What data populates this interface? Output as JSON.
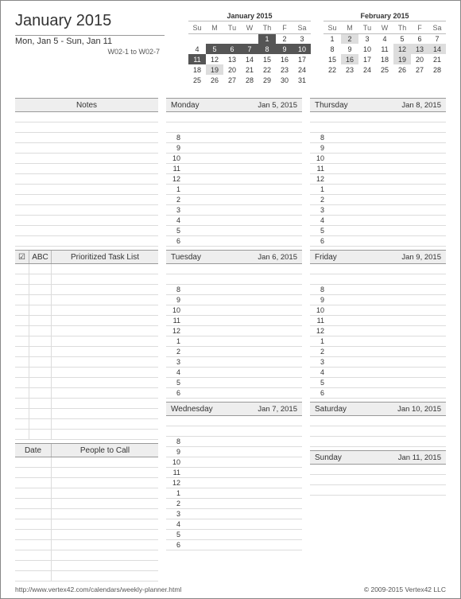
{
  "title": "January 2015",
  "week_range": "Mon, Jan 5  -  Sun, Jan 11",
  "week_codes": "W02-1 to W02-7",
  "minicals": [
    {
      "title": "January 2015",
      "dows": [
        "Su",
        "M",
        "Tu",
        "W",
        "Th",
        "F",
        "Sa"
      ],
      "cells": [
        [
          "",
          "",
          "",
          "",
          "1",
          "2",
          "3"
        ],
        [
          "4",
          "5",
          "6",
          "7",
          "8",
          "9",
          "10"
        ],
        [
          "11",
          "12",
          "13",
          "14",
          "15",
          "16",
          "17"
        ],
        [
          "18",
          "19",
          "20",
          "21",
          "22",
          "23",
          "24"
        ],
        [
          "25",
          "26",
          "27",
          "28",
          "29",
          "30",
          "31"
        ]
      ],
      "highlight_dark": [
        "1",
        "5",
        "6",
        "7",
        "8",
        "9",
        "10",
        "11"
      ],
      "highlight_light": [
        "19"
      ]
    },
    {
      "title": "February 2015",
      "dows": [
        "Su",
        "M",
        "Tu",
        "W",
        "Th",
        "F",
        "Sa"
      ],
      "cells": [
        [
          "1",
          "2",
          "3",
          "4",
          "5",
          "6",
          "7"
        ],
        [
          "8",
          "9",
          "10",
          "11",
          "12",
          "13",
          "14"
        ],
        [
          "15",
          "16",
          "17",
          "18",
          "19",
          "20",
          "21"
        ],
        [
          "22",
          "23",
          "24",
          "25",
          "26",
          "27",
          "28"
        ],
        [
          "",
          "",
          "",
          "",
          "",
          "",
          ""
        ]
      ],
      "highlight_dark": [],
      "highlight_light": [
        "2",
        "12",
        "13",
        "14",
        "16",
        "19"
      ]
    }
  ],
  "left_sections": {
    "notes": {
      "label": "Notes",
      "lines": 13
    },
    "tasks": {
      "check": "☑",
      "abc": "ABC",
      "label": "Prioritized Task List",
      "lines": 17
    },
    "people": {
      "date": "Date",
      "label": "People to Call",
      "lines": 12
    }
  },
  "hours": [
    "8",
    "9",
    "10",
    "11",
    "12",
    "1",
    "2",
    "3",
    "4",
    "5",
    "6"
  ],
  "days_col1": [
    {
      "name": "Monday",
      "date": "Jan 5, 2015"
    },
    {
      "name": "Tuesday",
      "date": "Jan 6, 2015"
    },
    {
      "name": "Wednesday",
      "date": "Jan 7, 2015"
    }
  ],
  "days_col2": [
    {
      "name": "Thursday",
      "date": "Jan 8, 2015"
    },
    {
      "name": "Friday",
      "date": "Jan 9, 2015"
    },
    {
      "name": "Saturday",
      "date": "Jan 10, 2015",
      "short": true
    },
    {
      "name": "Sunday",
      "date": "Jan 11, 2015",
      "short": true
    }
  ],
  "footer": {
    "url": "http://www.vertex42.com/calendars/weekly-planner.html",
    "copyright": "© 2009-2015 Vertex42 LLC"
  }
}
